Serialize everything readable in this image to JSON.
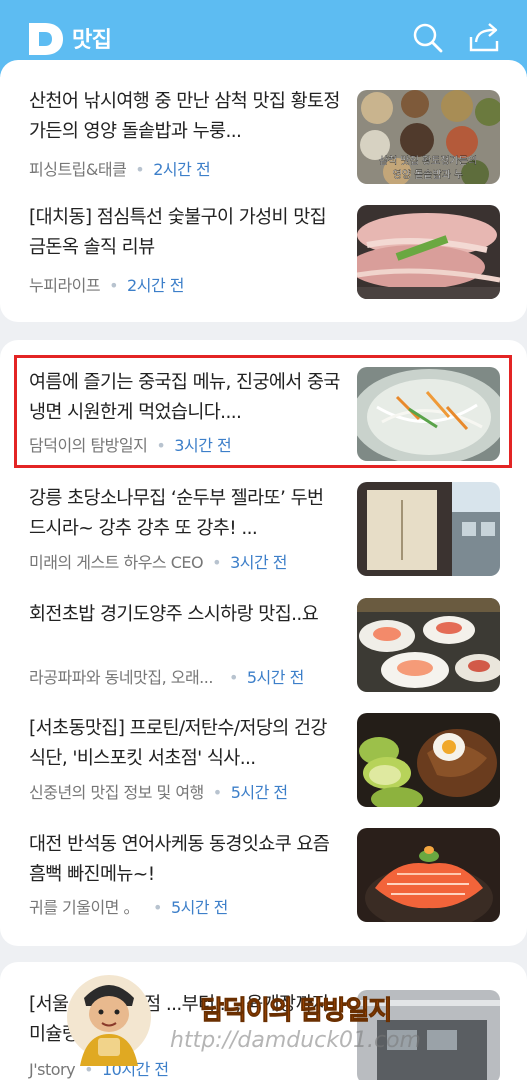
{
  "header": {
    "title": "맛집",
    "logo_letter": "D",
    "search_icon": "search-icon",
    "share_icon": "share-icon",
    "color": "#5dbcf2"
  },
  "items": [
    {
      "title": "산천어 낚시여행 중 만난 삼척 맛집 황토정가든의 영양 돌솥밥과 누룽...",
      "source": "피싱트립&태클",
      "time": "2시간 전",
      "thumb_text": [
        "삼척 맛집 황토정가든의",
        "영양 돌솥밥과 누"
      ]
    },
    {
      "title": "[대치동] 점심특선 숯불구이 가성비 맛집 금돈옥 솔직 리뷰",
      "source": "누피라이프",
      "time": "2시간 전"
    },
    {
      "title": "여름에 즐기는 중국집 메뉴, 진궁에서 중국냉면 시원한게 먹었습니다....",
      "source": "담덕이의 탐방일지",
      "time": "3시간 전"
    },
    {
      "title": "강릉 초당소나무집 ‘순두부 젤라또’ 두번 드시라~ 강추 강추 또 강추! ...",
      "source": "미래의 게스트 하우스 CEO",
      "time": "3시간 전"
    },
    {
      "title": "회전초밥 경기도양주 스시하랑 맛집..요",
      "source": "라공파파와 동네맛집, 오래...",
      "time": "5시간 전"
    },
    {
      "title": "[서초동맛집] 프로틴/저탄수/저당의 건강식단, '비스포킷 서초점' 식사...",
      "source": "신중년의 맛집 정보 및 여행",
      "time": "5시간 전"
    },
    {
      "title": "대전 반석동 연어사케동 동경잇쇼쿠 요즘 흠뻑 빠진메뉴~!",
      "source": "귀를 기울이면 。",
      "time": "5시간 전"
    },
    {
      "title": "[서울 ...태옥 본점 ...부터 ..., 육개장까지 미슐랭...",
      "source": "J'story",
      "time": "10시간 전"
    }
  ],
  "watermark": {
    "text": "담덕이의 탐방일지",
    "url": "http://damduck01.com"
  }
}
